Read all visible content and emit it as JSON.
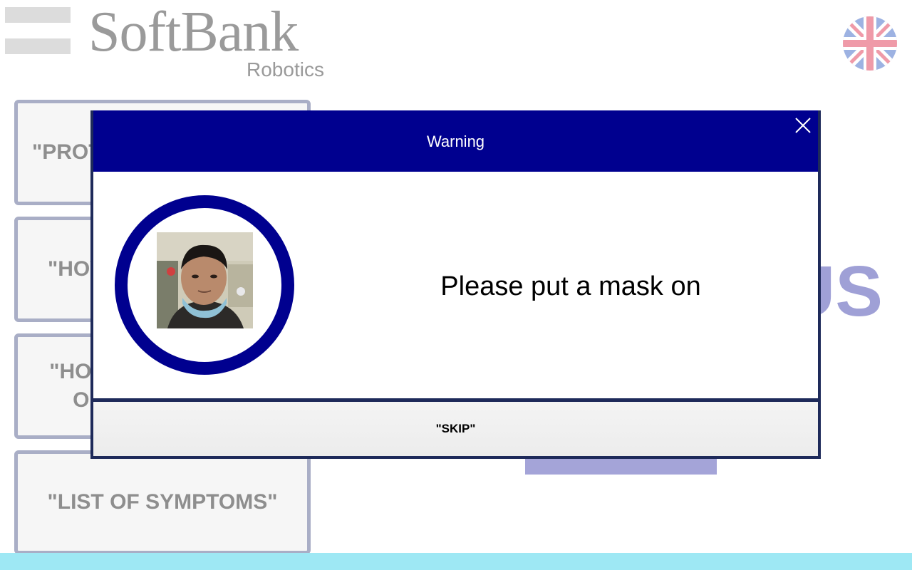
{
  "brand": {
    "main": "SoftBank",
    "sub": "Robotics"
  },
  "language": {
    "icon": "uk-flag-icon"
  },
  "menu": {
    "items": [
      {
        "label": "\"PROT"
      },
      {
        "label": "\"HOV"
      },
      {
        "line1": "\"HOW",
        "line2": "OI"
      },
      {
        "label": "\"LIST OF SYMPTOMS\""
      }
    ]
  },
  "background": {
    "big_text": "US"
  },
  "dialog": {
    "title": "Warning",
    "message": "Please put a mask on",
    "skip_label": "\"SKIP\"",
    "close_icon": "close-icon"
  },
  "colors": {
    "header": "#00008f",
    "ring": "#00008f",
    "menu_border": "#a9aec6",
    "accent_text": "#9fa0d6",
    "bottom_bar": "#9ee8f4"
  }
}
